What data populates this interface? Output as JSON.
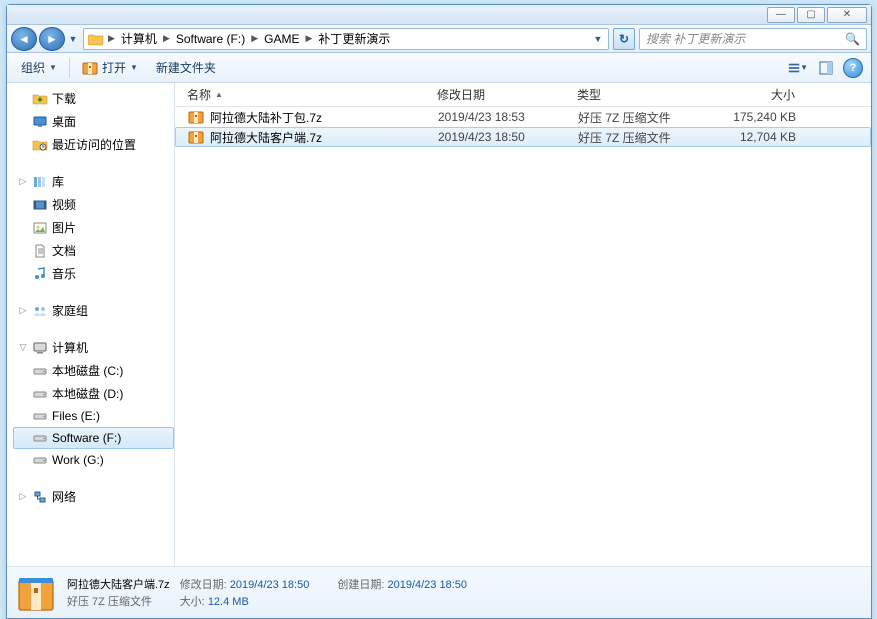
{
  "titlebar": {
    "min": "—",
    "max": "▢",
    "close": "✕"
  },
  "nav": {
    "breadcrumbs": [
      "计算机",
      "Software (F:)",
      "GAME",
      "补丁更新演示"
    ],
    "search_placeholder": "搜索 补丁更新演示"
  },
  "toolbar": {
    "organize": "组织",
    "open": "打开",
    "new_folder": "新建文件夹"
  },
  "sidebar": {
    "fav_items": [
      {
        "icon": "download",
        "label": "下载"
      },
      {
        "icon": "desktop",
        "label": "桌面"
      },
      {
        "icon": "recent",
        "label": "最近访问的位置"
      }
    ],
    "libraries_label": "库",
    "library_items": [
      {
        "icon": "video",
        "label": "视频"
      },
      {
        "icon": "picture",
        "label": "图片"
      },
      {
        "icon": "document",
        "label": "文档"
      },
      {
        "icon": "music",
        "label": "音乐"
      }
    ],
    "homegroup_label": "家庭组",
    "computer_label": "计算机",
    "drives": [
      {
        "label": "本地磁盘 (C:)"
      },
      {
        "label": "本地磁盘 (D:)"
      },
      {
        "label": "Files (E:)"
      },
      {
        "label": "Software (F:)"
      },
      {
        "label": "Work (G:)"
      }
    ],
    "network_label": "网络"
  },
  "columns": {
    "name": "名称",
    "date": "修改日期",
    "type": "类型",
    "size": "大小"
  },
  "files": [
    {
      "name": "阿拉德大陆补丁包.7z",
      "date": "2019/4/23 18:53",
      "type": "好压 7Z 压缩文件",
      "size": "175,240 KB"
    },
    {
      "name": "阿拉德大陆客户端.7z",
      "date": "2019/4/23 18:50",
      "type": "好压 7Z 压缩文件",
      "size": "12,704 KB"
    }
  ],
  "details": {
    "name": "阿拉德大陆客户端.7z",
    "type": "好压 7Z 压缩文件",
    "mod_label": "修改日期:",
    "mod_val": "2019/4/23 18:50",
    "create_label": "创建日期:",
    "create_val": "2019/4/23 18:50",
    "size_label": "大小:",
    "size_val": "12.4 MB"
  }
}
